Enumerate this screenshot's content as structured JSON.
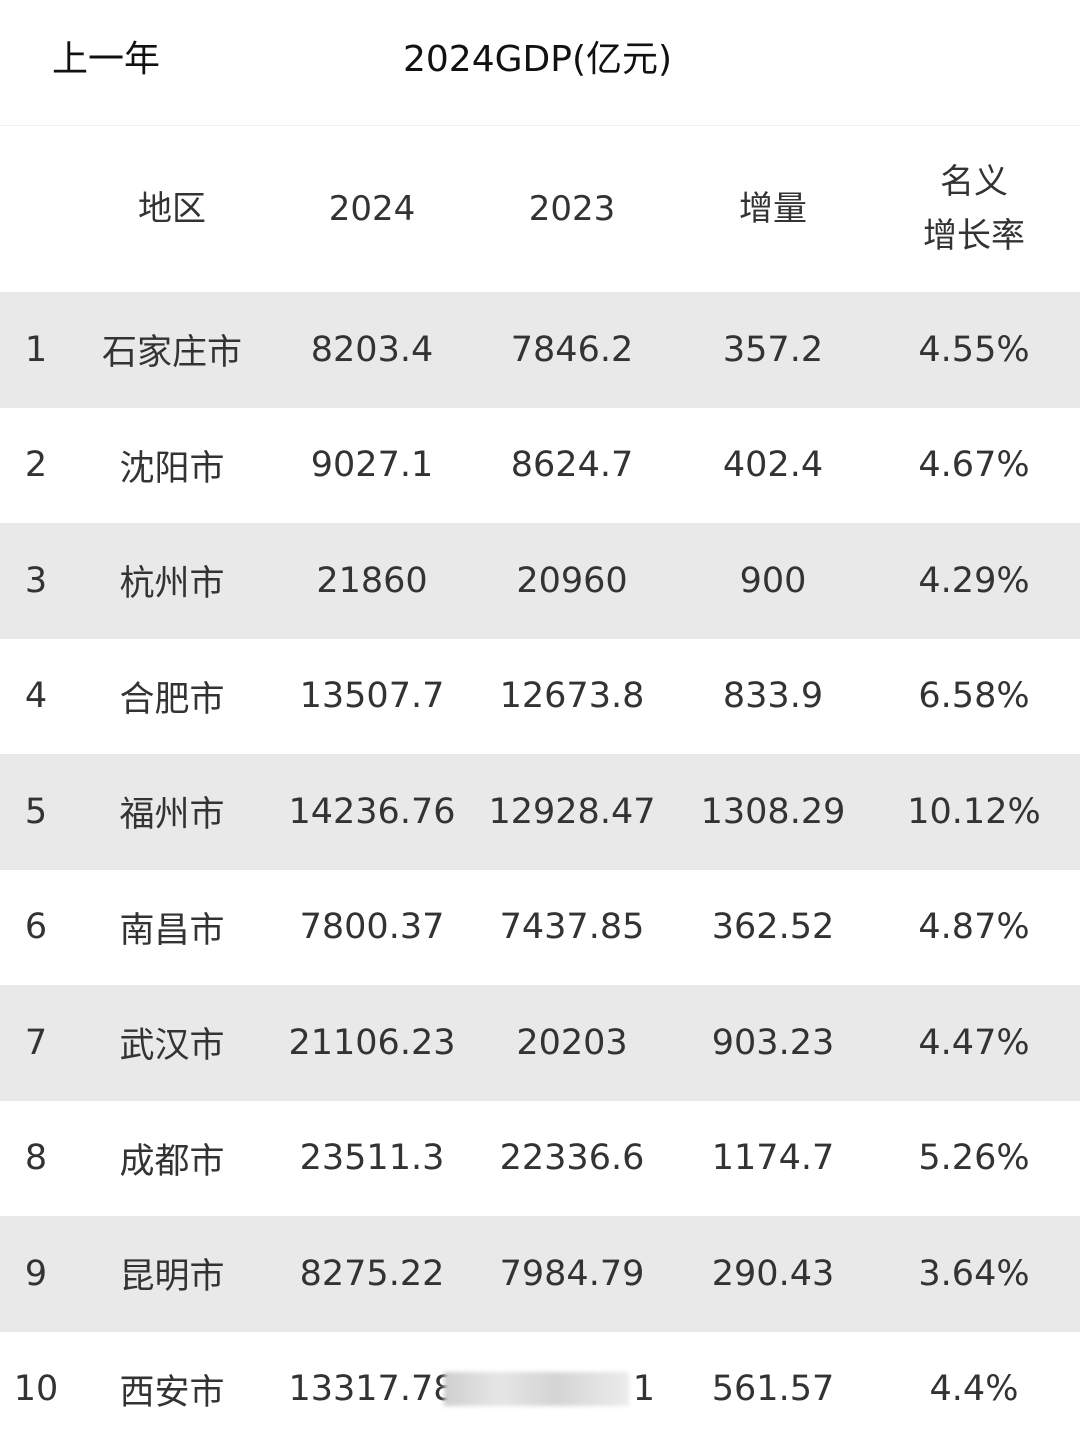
{
  "header": {
    "prev_label": "上一年",
    "title": "2024GDP(亿元)"
  },
  "table": {
    "columns": [
      "",
      "地区",
      "2024",
      "2023",
      "增量",
      "名义\n增长率"
    ],
    "rate_header_line1": "名义",
    "rate_header_line2": "增长率",
    "rows": [
      {
        "rank": "1",
        "region": "石家庄市",
        "gdp2024": "8203.4",
        "gdp2023": "7846.2",
        "increase": "357.2",
        "rate": "4.55%"
      },
      {
        "rank": "2",
        "region": "沈阳市",
        "gdp2024": "9027.1",
        "gdp2023": "8624.7",
        "increase": "402.4",
        "rate": "4.67%"
      },
      {
        "rank": "3",
        "region": "杭州市",
        "gdp2024": "21860",
        "gdp2023": "20960",
        "increase": "900",
        "rate": "4.29%"
      },
      {
        "rank": "4",
        "region": "合肥市",
        "gdp2024": "13507.7",
        "gdp2023": "12673.8",
        "increase": "833.9",
        "rate": "6.58%"
      },
      {
        "rank": "5",
        "region": "福州市",
        "gdp2024": "14236.76",
        "gdp2023": "12928.47",
        "increase": "1308.29",
        "rate": "10.12%"
      },
      {
        "rank": "6",
        "region": "南昌市",
        "gdp2024": "7800.37",
        "gdp2023": "7437.85",
        "increase": "362.52",
        "rate": "4.87%"
      },
      {
        "rank": "7",
        "region": "武汉市",
        "gdp2024": "21106.23",
        "gdp2023": "20203",
        "increase": "903.23",
        "rate": "4.47%"
      },
      {
        "rank": "8",
        "region": "成都市",
        "gdp2024": "23511.3",
        "gdp2023": "22336.6",
        "increase": "1174.7",
        "rate": "5.26%"
      },
      {
        "rank": "9",
        "region": "昆明市",
        "gdp2024": "8275.22",
        "gdp2023": "7984.79",
        "increase": "290.43",
        "rate": "3.64%"
      },
      {
        "rank": "10",
        "region": "西安市",
        "gdp2024": "13317.78",
        "gdp2023": "1",
        "increase": "561.57",
        "rate": "4.4%"
      }
    ]
  },
  "colors": {
    "row_shade": "#e9e9e9",
    "row_plain": "#ffffff",
    "text": "#333333"
  }
}
